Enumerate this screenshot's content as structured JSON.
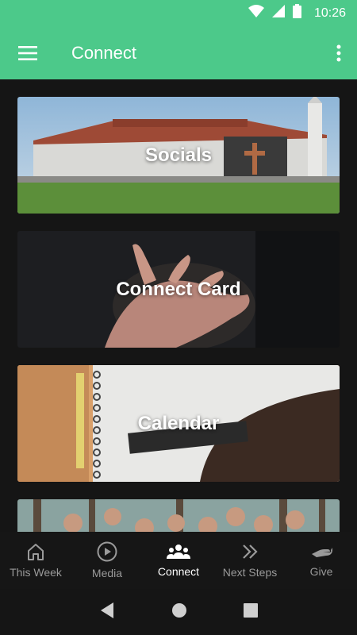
{
  "status_bar": {
    "time": "10:26",
    "icons": [
      "wifi-icon",
      "signal-icon",
      "battery-icon"
    ]
  },
  "app_bar": {
    "title": "Connect",
    "menu_icon": "hamburger-menu-icon",
    "overflow_icon": "more-vert-icon"
  },
  "cards": [
    {
      "label": "Socials",
      "image": "church-building-photo"
    },
    {
      "label": "Connect Card",
      "image": "open-hand-photo"
    },
    {
      "label": "Calendar",
      "image": "notebook-hand-photo"
    },
    {
      "label": "",
      "image": "group-photo"
    }
  ],
  "bottom_nav": {
    "items": [
      {
        "label": "This Week",
        "icon": "home-icon",
        "active": false
      },
      {
        "label": "Media",
        "icon": "play-circle-icon",
        "active": false
      },
      {
        "label": "Connect",
        "icon": "group-icon",
        "active": true
      },
      {
        "label": "Next Steps",
        "icon": "double-chevron-icon",
        "active": false
      },
      {
        "label": "Give",
        "icon": "give-hand-icon",
        "active": false
      }
    ]
  },
  "colors": {
    "accent": "#4cc98a",
    "background": "#151515",
    "nav_active": "#ffffff",
    "nav_inactive": "#9a9a9a"
  }
}
